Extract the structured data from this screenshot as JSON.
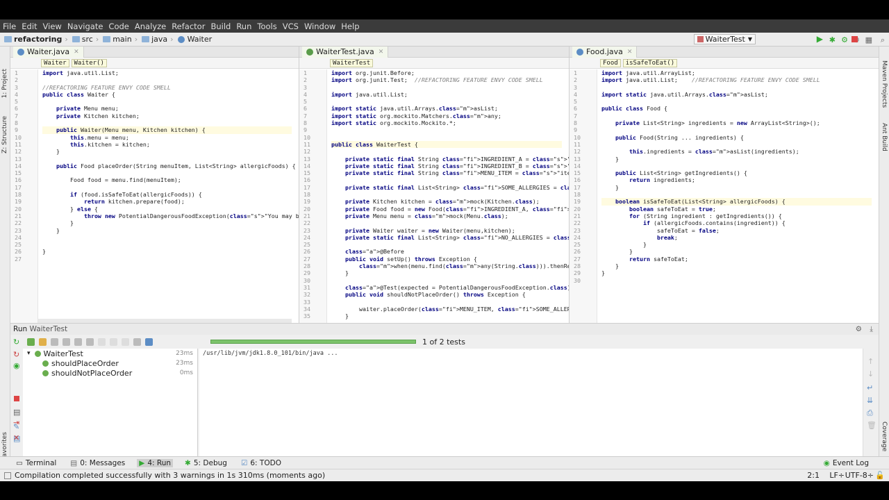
{
  "menu": [
    "File",
    "Edit",
    "View",
    "Navigate",
    "Code",
    "Analyze",
    "Refactor",
    "Build",
    "Run",
    "Tools",
    "VCS",
    "Window",
    "Help"
  ],
  "breadcrumb": [
    {
      "label": "refactoring",
      "bold": true
    },
    {
      "label": "src"
    },
    {
      "label": "main"
    },
    {
      "label": "java"
    },
    {
      "label": "Waiter"
    }
  ],
  "run_config": "WaiterTest",
  "left_strip": {
    "project": "1: Project",
    "structure": "Z: Structure",
    "favorites": "2: Favorites"
  },
  "right_strip": {
    "maven": "Maven Projects",
    "ant": "Ant Build",
    "coverage": "Coverage"
  },
  "editors": [
    {
      "tab": "Waiter.java",
      "breadcrumbs": [
        "Waiter",
        "Waiter()"
      ],
      "lines": [
        "import java.util.List;",
        "",
        "//REFACTORING FEATURE ENVY CODE SMELL",
        "public class Waiter {",
        "",
        "    private Menu menu;",
        "    private Kitchen kitchen;",
        "",
        "    public Waiter(Menu menu, Kitchen kitchen) {",
        "        this.menu = menu;",
        "        this.kitchen = kitchen;",
        "    }",
        "",
        "    public Food placeOrder(String menuItem, List<String> allergicFoods) {",
        "",
        "        Food food = menu.find(menuItem);",
        "",
        "        if (food.isSafeToEat(allergicFoods)) {",
        "            return kitchen.prepare(food);",
        "        } else {",
        "            throw new PotentialDangerousFoodException(\"You may be alergic!\");",
        "        }",
        "    }",
        "",
        "",
        "}",
        ""
      ]
    },
    {
      "tab": "WaiterTest.java",
      "breadcrumbs": [
        "WaiterTest"
      ],
      "lines": [
        "import org.junit.Before;",
        "import org.junit.Test;  //REFACTORING FEATURE ENVY CODE SMELL",
        "",
        "import java.util.List;",
        "",
        "import static java.util.Arrays.asList;",
        "import static org.mockito.Matchers.any;",
        "import static org.mockito.Mockito.*;",
        "",
        "",
        "public class WaiterTest {",
        "",
        "    private static final String INGREDIENT_A = \"A\";",
        "    private static final String INGREDIENT_B = \"B\";",
        "    private static final String MENU_ITEM = \"item\";",
        "",
        "    private static final List<String> SOME_ALLERGIES = asList( a: \"A\");",
        "",
        "    private Kitchen kitchen = mock(Kitchen.class);",
        "    private Food food = new Food(INGREDIENT_A, INGREDIENT_B);",
        "    private Menu menu = mock(Menu.class);",
        "",
        "    private Waiter waiter = new Waiter(menu,kitchen);",
        "    private static final List<String> NO_ALLERGIES = asList();",
        "",
        "    @Before",
        "    public void setUp() throws Exception {",
        "        when(menu.find(any(String.class))).thenReturn(food);",
        "    }",
        "",
        "    @Test(expected = PotentialDangerousFoodException.class)",
        "    public void shouldNotPlaceOrder() throws Exception {",
        "",
        "        waiter.placeOrder(MENU_ITEM, SOME_ALLERGIES);",
        "    }"
      ]
    },
    {
      "tab": "Food.java",
      "breadcrumbs": [
        "Food",
        "isSafeToEat()"
      ],
      "lines": [
        "import java.util.ArrayList;",
        "import java.util.List;    //REFACTORING FEATURE ENVY CODE SMELL",
        "",
        "import static java.util.Arrays.asList;",
        "",
        "public class Food {",
        "",
        "    private List<String> ingredients = new ArrayList<String>();",
        "",
        "    public Food(String ... ingredients) {",
        "",
        "        this.ingredients = asList(ingredients);",
        "    }",
        "",
        "    public List<String> getIngredients() {",
        "        return ingredients;",
        "    }",
        "",
        "    boolean isSafeToEat(List<String> allergicFoods) {",
        "        boolean safeToEat = true;",
        "        for (String ingredient : getIngredients()) {",
        "            if (allergicFoods.contains(ingredient)) {",
        "                safeToEat = false;",
        "                break;",
        "            }",
        "        }",
        "        return safeToEat;",
        "    }",
        "}",
        ""
      ]
    }
  ],
  "run_panel": {
    "title_prefix": "Run",
    "title_config": "WaiterTest",
    "progress_text": "1 of 2 tests",
    "progress_fraction": 1.0,
    "tree": [
      {
        "label": "WaiterTest",
        "duration": "23ms",
        "level": 0
      },
      {
        "label": "shouldPlaceOrder",
        "duration": "23ms",
        "level": 1
      },
      {
        "label": "shouldNotPlaceOrder",
        "duration": "0ms",
        "level": 1
      }
    ],
    "console": "/usr/lib/jvm/jdk1.8.0_101/bin/java ..."
  },
  "bottom_tabs": [
    {
      "label": "Terminal",
      "active": false
    },
    {
      "label": "0: Messages",
      "active": false
    },
    {
      "label": "4: Run",
      "active": true
    },
    {
      "label": "5: Debug",
      "active": false
    },
    {
      "label": "6: TODO",
      "active": false
    }
  ],
  "event_log": "Event Log",
  "status": {
    "message": "Compilation completed successfully with 3 warnings in 1s 310ms (moments ago)",
    "position": "2:1",
    "line_sep": "LF÷",
    "encoding": "UTF-8÷"
  },
  "colors": {
    "menubar": "#3b3b3b",
    "progress": "#7cc36b",
    "keyword": "#000080",
    "field": "#660e7a",
    "string": "#008000",
    "comment": "#808080"
  }
}
